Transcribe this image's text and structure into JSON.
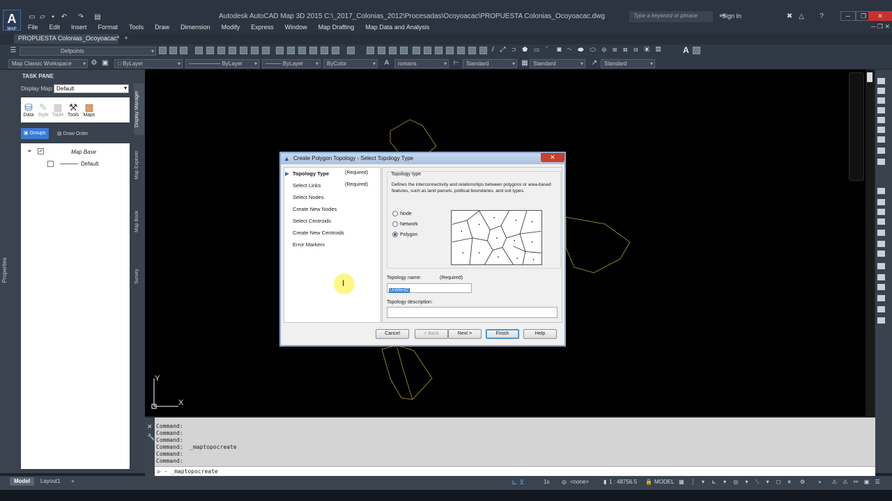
{
  "app": {
    "logo_text": "A",
    "logo_sub": "MAP",
    "title": "Autodesk AutoCAD Map 3D 2015    C:\\_2017_Colonias_2012\\Procesadas\\Ocoyoacac\\PROPUESTA Colonias_Ocoyoacac.dwg",
    "search_placeholder": "Type a keyword or phrase",
    "sign_in": "Sign In"
  },
  "menu": [
    "File",
    "Edit",
    "Insert",
    "Format",
    "Tools",
    "Draw",
    "Dimension",
    "Modify",
    "Express",
    "Window",
    "Map Drafting",
    "Map Data and Analysis"
  ],
  "doc_tab": "PROPUESTA Colonias_Ocoyoacac*",
  "toolbar": {
    "layer": "Defpoints",
    "workspace": "Map Classic Workspace",
    "color": "ByLayer",
    "linetype": "ByLayer",
    "lineweight": "ByLayer",
    "plotstyle": "ByColor",
    "textstyle": "romans",
    "dimstyle": "Standard",
    "tablestyle": "Standard",
    "mleaderstyle": "Standard"
  },
  "taskpane": {
    "title": "TASK PANE",
    "display_map_label": "Display Map:",
    "display_map_value": "Default",
    "tools": [
      "Data",
      "Style",
      "Table",
      "Tools",
      "Maps"
    ],
    "groups_btn": "Groups",
    "draw_order": "Draw Order",
    "tree": {
      "root": "Map Base",
      "child": "Default"
    },
    "vtabs": [
      "Display Manager",
      "Map Explorer",
      "Map Book",
      "Survey"
    ],
    "properties": "Properties"
  },
  "ucs": {
    "x": "X",
    "y": "Y"
  },
  "dialog": {
    "title": "Create Polygon Topology - Select Topology Type",
    "close": "✕",
    "nav": [
      {
        "label": "Topology Type",
        "req": "(Required)",
        "active": true
      },
      {
        "label": "Select Links",
        "req": "(Required)"
      },
      {
        "label": "Select Nodes",
        "req": ""
      },
      {
        "label": "Create New Nodes",
        "req": ""
      },
      {
        "label": "Select Centroids",
        "req": ""
      },
      {
        "label": "Create New Centroids",
        "req": ""
      },
      {
        "label": "Error Markers",
        "req": ""
      }
    ],
    "topology_type_label": "Topology type",
    "topology_type_desc": "Defines the interconnectivity and relationships between polygons or area-based features, such as land parcels, political boundaries, and soil types.",
    "options": [
      "Node",
      "Network",
      "Polygon"
    ],
    "selected_option": "Polygon",
    "name_label": "Topology name:",
    "name_required": "(Required)",
    "name_value": "Untitled2",
    "desc_label": "Topology description:",
    "desc_value": "",
    "buttons": {
      "cancel": "Cancel",
      "back": "< Back",
      "next": "Next >",
      "finish": "Finish",
      "help": "Help"
    }
  },
  "command": {
    "history": [
      "Command:",
      "Command:",
      "Command:",
      "Command:  _maptopocreate",
      "Command:",
      "Command:"
    ],
    "input": "- _maptopocreate"
  },
  "statusbar": {
    "tabs": [
      "Model",
      "Layout1",
      "+"
    ],
    "scale": "1x",
    "annot": "<none>",
    "map_scale": "1 : 48756.5",
    "mode": "MODEL"
  }
}
